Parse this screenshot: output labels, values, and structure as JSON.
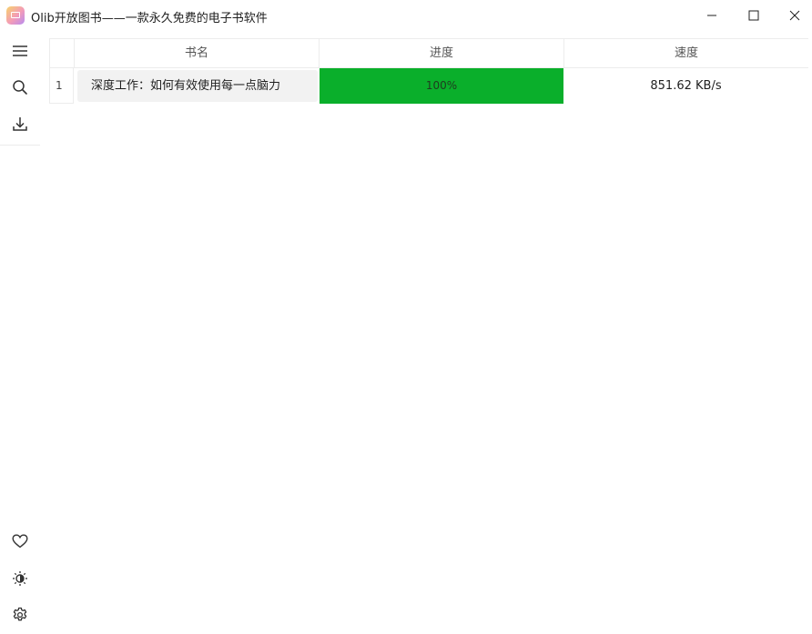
{
  "window": {
    "title": "Olib开放图书——一款永久免费的电子书软件",
    "controls": {
      "minimize": "minimize-icon",
      "maximize": "maximize-icon",
      "close": "close-icon"
    }
  },
  "sidebar": {
    "top_items": [
      {
        "icon": "menu-icon"
      },
      {
        "icon": "search-icon"
      },
      {
        "icon": "download-icon"
      }
    ],
    "bottom_items": [
      {
        "icon": "heart-icon"
      },
      {
        "icon": "theme-contrast-icon"
      },
      {
        "icon": "gear-icon"
      }
    ]
  },
  "downloads_table": {
    "columns": {
      "name": "书名",
      "progress": "进度",
      "speed": "速度"
    },
    "rows": [
      {
        "index": "1",
        "name": "深度工作：如何有效使用每一点脑力",
        "progress_label": "100%",
        "progress": 1.0,
        "speed": "851.62 KB/s"
      }
    ]
  },
  "colors": {
    "progress_fill": "#0aaf2b",
    "row_background": "#f2f2f2",
    "border": "#ececec"
  }
}
